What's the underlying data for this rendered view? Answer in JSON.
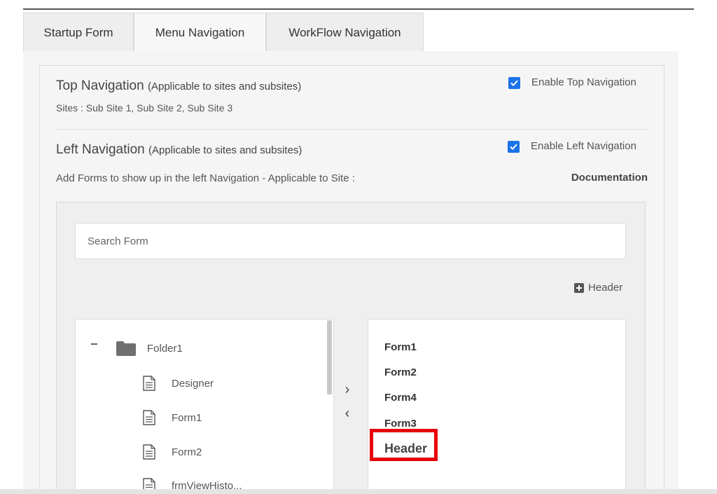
{
  "tabs": [
    {
      "label": "Startup Form"
    },
    {
      "label": "Menu Navigation"
    },
    {
      "label": "WorkFlow Navigation"
    }
  ],
  "top_nav": {
    "title": "Top Navigation",
    "qualifier": "(Applicable to sites and subsites)",
    "sites_text": "Sites : Sub Site 1, Sub Site 2, Sub Site 3",
    "checkbox_label": "Enable Top Navigation",
    "checked": true
  },
  "left_nav": {
    "title": "Left Navigation",
    "qualifier": "(Applicable to sites and subsites)",
    "description": "Add Forms to show up in the left Navigation - Applicable to Site :",
    "site_name": "Documentation",
    "checkbox_label": "Enable Left Navigation",
    "checked": true
  },
  "search": {
    "placeholder": "Search Form"
  },
  "add_header_label": "Header",
  "tree": {
    "folder": "Folder1",
    "children": [
      "Designer",
      "Form1",
      "Form2",
      "frmViewHisto..."
    ]
  },
  "arrows": {
    "right": "›",
    "left": "‹"
  },
  "selected_list": [
    "Form1",
    "Form2",
    "Form4",
    "Form3",
    "Header"
  ],
  "icons": {
    "checkbox": "checkmark-icon",
    "folder": "folder-icon",
    "document": "document-icon",
    "add": "plus-square-icon"
  },
  "colors": {
    "checkbox": "#1a73e8",
    "highlight": "#e8000b"
  }
}
